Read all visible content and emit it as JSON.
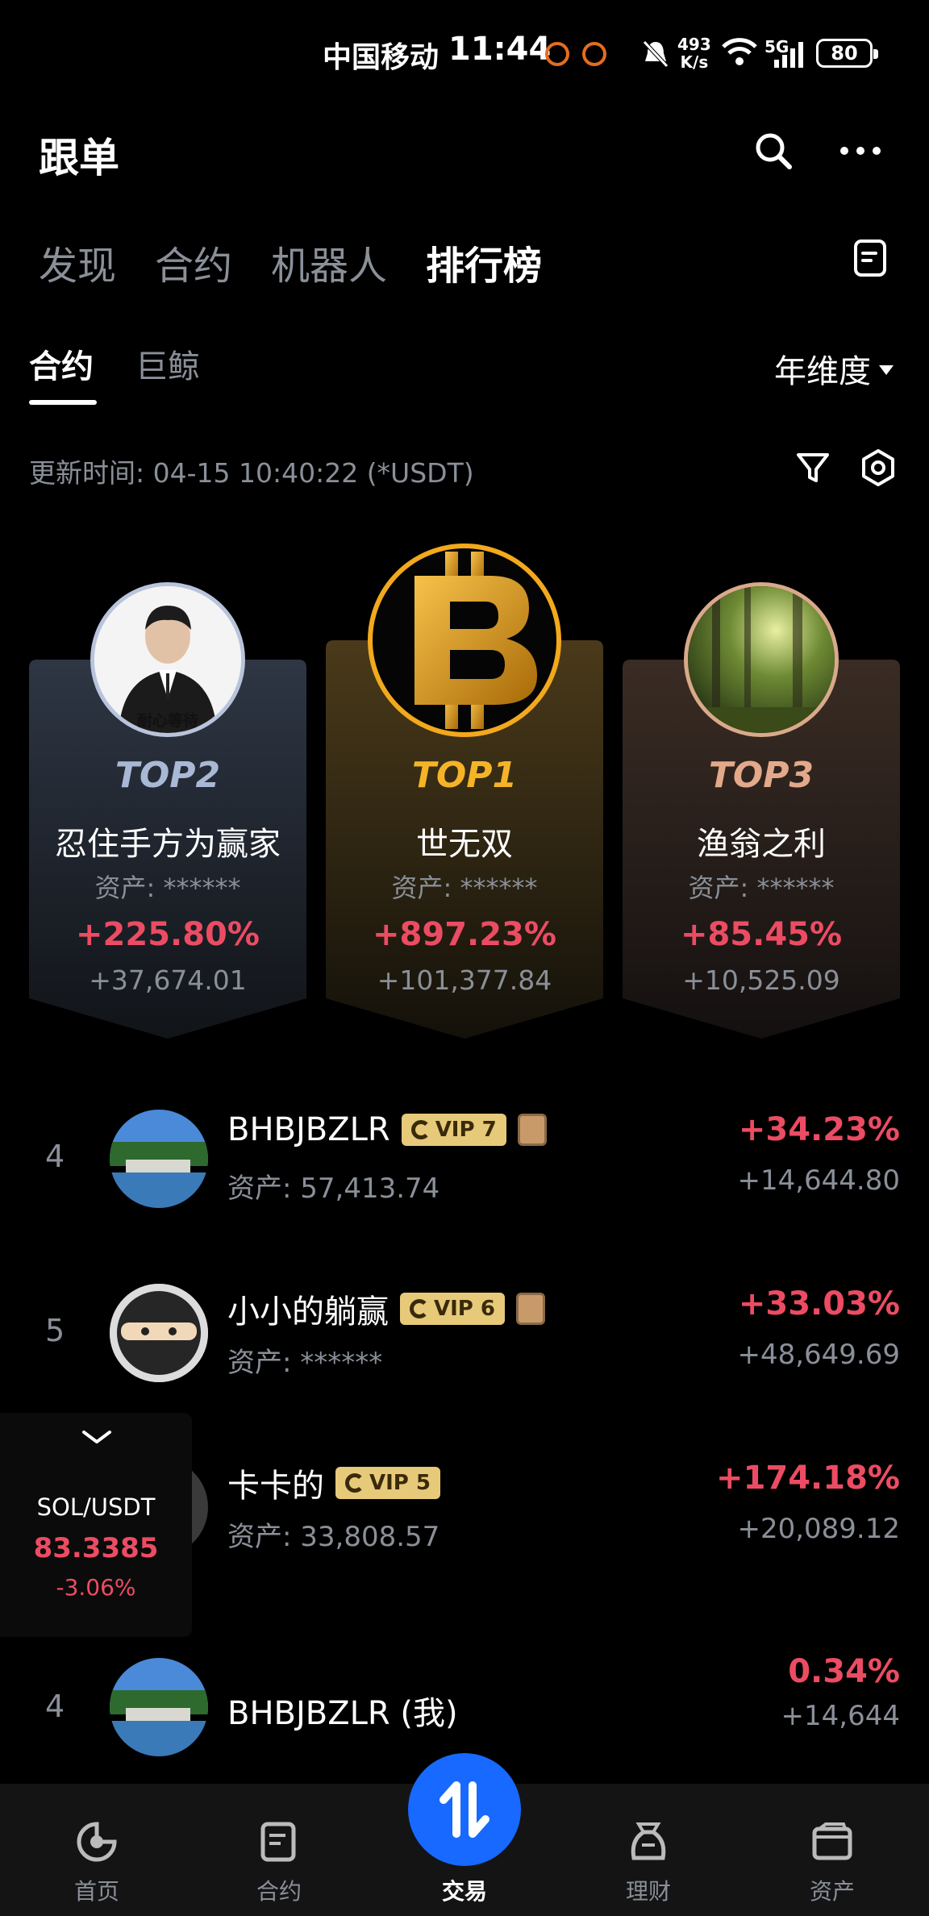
{
  "status_bar": {
    "carrier": "中国移动",
    "time": "11:44",
    "net_speed_value": "493",
    "net_speed_unit": "K/s",
    "network": "5G",
    "battery": "80"
  },
  "header": {
    "title": "跟单"
  },
  "main_tabs": [
    {
      "label": "发现"
    },
    {
      "label": "合约"
    },
    {
      "label": "机器人"
    },
    {
      "label": "排行榜"
    }
  ],
  "sub_tabs": [
    {
      "label": "合约"
    },
    {
      "label": "巨鲸"
    }
  ],
  "period_selector": "年维度",
  "update_time": "更新时间: 04-15 10:40:22 (*USDT)",
  "podium": [
    {
      "rank": "TOP2",
      "name": "忍住手方为赢家",
      "asset": "资产: ******",
      "pct": "+225.80%",
      "pnl": "+37,674.01",
      "avatar_caption": "耐心等待"
    },
    {
      "rank": "TOP1",
      "name": "世无双",
      "asset": "资产: ******",
      "pct": "+897.23%",
      "pnl": "+101,377.84"
    },
    {
      "rank": "TOP3",
      "name": "渔翁之利",
      "asset": "资产: ******",
      "pct": "+85.45%",
      "pnl": "+10,525.09"
    }
  ],
  "rows": [
    {
      "num": "4",
      "name": "BHBJBZLR",
      "vip": "VIP 7",
      "asset": "资产: 57,413.74",
      "pct": "+34.23%",
      "pnl": "+14,644.80"
    },
    {
      "num": "5",
      "name": "小小的躺赢",
      "vip": "VIP 6",
      "asset": "资产: ******",
      "pct": "+33.03%",
      "pnl": "+48,649.69"
    },
    {
      "num": "",
      "name": "卡卡的",
      "vip": "VIP 5",
      "asset": "资产: 33,808.57",
      "pct": "+174.18%",
      "pnl": "+20,089.12"
    }
  ],
  "my_row": {
    "num": "4",
    "name": "BHBJBZLR (我)",
    "pct": "0.34%",
    "pnl": "+14,644"
  },
  "ticker": {
    "pair": "SOL/USDT",
    "price": "83.3385",
    "change": "-3.06%"
  },
  "bottom_nav": [
    {
      "label": "首页",
      "icon": "home-icon"
    },
    {
      "label": "合约",
      "icon": "contract-icon"
    },
    {
      "label": "交易",
      "icon": "trade-icon"
    },
    {
      "label": "理财",
      "icon": "wealth-icon"
    },
    {
      "label": "资产",
      "icon": "wallet-icon"
    }
  ],
  "colors": {
    "profit": "#ec4c63",
    "accent": "#1769ff",
    "gold": "#e7a51a"
  }
}
